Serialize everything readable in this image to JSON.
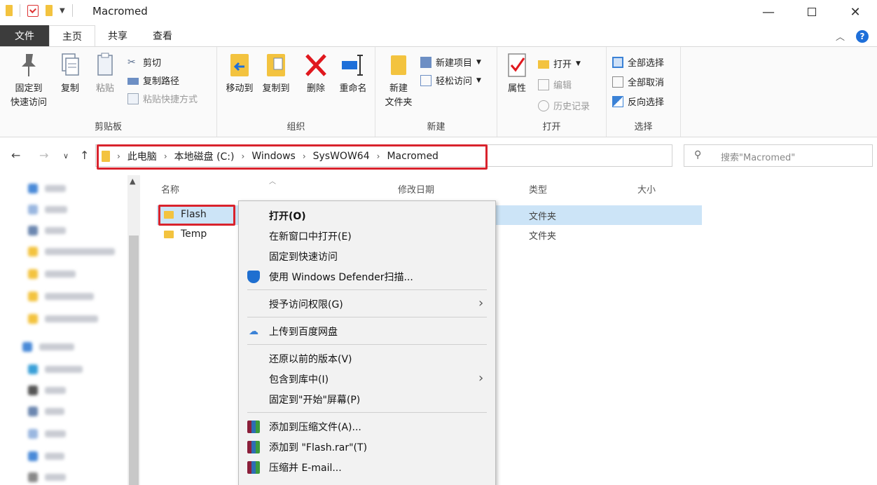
{
  "window": {
    "title": "Macromed",
    "minimize": "—",
    "close": "✕"
  },
  "ribbon_tabs": {
    "file": "文件",
    "home": "主页",
    "share": "共享",
    "view": "查看"
  },
  "ribbon": {
    "clipboard": {
      "label": "剪贴板",
      "pin_line1": "固定到",
      "pin_line2": "快速访问",
      "copy": "复制",
      "paste": "粘贴",
      "cut": "剪切",
      "copy_path": "复制路径",
      "paste_shortcut": "粘贴快捷方式"
    },
    "organize": {
      "label": "组织",
      "move_to": "移动到",
      "copy_to": "复制到",
      "delete": "删除",
      "rename": "重命名"
    },
    "new": {
      "label": "新建",
      "new_folder_line1": "新建",
      "new_folder_line2": "文件夹",
      "new_item": "新建项目",
      "easy_access": "轻松访问"
    },
    "open": {
      "label": "打开",
      "properties": "属性",
      "open": "打开",
      "edit": "编辑",
      "history": "历史记录"
    },
    "select": {
      "label": "选择",
      "select_all": "全部选择",
      "select_none": "全部取消",
      "invert": "反向选择"
    }
  },
  "address": {
    "crumbs": [
      "此电脑",
      "本地磁盘 (C:)",
      "Windows",
      "SysWOW64",
      "Macromed"
    ],
    "search_placeholder": "搜索\"Macromed\""
  },
  "columns": {
    "name": "名称",
    "modified": "修改日期",
    "type": "类型",
    "size": "大小"
  },
  "files": [
    {
      "name": "Flash",
      "type": "文件夹"
    },
    {
      "name": "Temp",
      "type": "文件夹"
    }
  ],
  "context_menu": {
    "open": "打开(O)",
    "open_new_window": "在新窗口中打开(E)",
    "pin_quick": "固定到快速访问",
    "defender": "使用 Windows Defender扫描...",
    "grant_access": "授予访问权限(G)",
    "upload_baidu": "上传到百度网盘",
    "restore_versions": "还原以前的版本(V)",
    "include_library": "包含到库中(I)",
    "pin_start": "固定到\"开始\"屏幕(P)",
    "add_archive": "添加到压缩文件(A)...",
    "add_flash_rar": "添加到 \"Flash.rar\"(T)",
    "compress_email": "压缩并 E-mail..."
  },
  "colors": {
    "highlight_red": "#d9232d",
    "selection_blue": "#cce4f7",
    "file_tab": "#3c3c3c",
    "folder_yellow": "#f3c33f"
  }
}
